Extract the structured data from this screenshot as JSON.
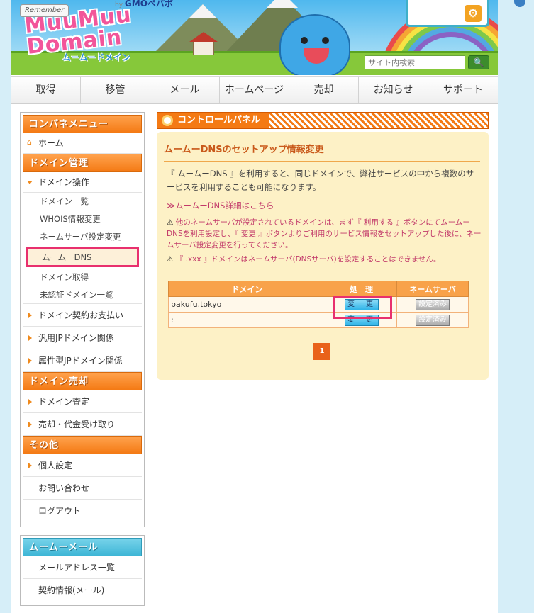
{
  "header": {
    "remember_badge": "Remember",
    "byline": "GMOペパボ",
    "logo_text": "MuuMuu Domain",
    "logo_sub": "ムームードメイン",
    "search": {
      "placeholder": "サイト内検索",
      "button_icon": "search-icon"
    },
    "login_icon": "gear-icon"
  },
  "nav": {
    "items": [
      {
        "label": "取得"
      },
      {
        "label": "移管"
      },
      {
        "label": "メール"
      },
      {
        "label": "ホームページ"
      },
      {
        "label": "売却"
      },
      {
        "label": "お知らせ"
      },
      {
        "label": "サポート"
      }
    ]
  },
  "sidebar": {
    "title": "コンパネメニュー",
    "home": "ホーム",
    "sections": {
      "domain_mgmt": "ドメイン管理",
      "domain_sale": "ドメイン売却",
      "other": "その他"
    },
    "domain_ops": "ドメイン操作",
    "domain_ops_items": [
      {
        "label": "ドメイン一覧"
      },
      {
        "label": "WHOIS情報変更"
      },
      {
        "label": "ネームサーバ設定変更"
      },
      {
        "label": "ムームーDNS"
      },
      {
        "label": "ドメイン取得"
      },
      {
        "label": "未認証ドメイン一覧"
      }
    ],
    "contract_payment": "ドメイン契約お支払い",
    "generic_jp": "汎用JPドメイン関係",
    "attribute_jp": "属性型JPドメイン関係",
    "appraisal": "ドメイン査定",
    "sale_payment": "売却・代金受け取り",
    "personal_settings": "個人設定",
    "contact": "お問い合わせ",
    "logout": "ログアウト"
  },
  "mail": {
    "title": "ムームーメール",
    "items": [
      {
        "label": "メールアドレス一覧"
      },
      {
        "label": "契約情報(メール)"
      }
    ]
  },
  "panel": {
    "title": "コントロールパネル",
    "heading": "ムームーDNSのセットアップ情報変更",
    "description": "『 ムームーDNS 』を利用すると、同じドメインで、弊社サービスの中から複数のサービスを利用することも可能になります。",
    "link": "ムームーDNS詳細はこちら",
    "note1": "他のネームサーバが設定されているドメインは、まず『 利用する 』ボタンにてムームーDNSを利用設定し、『 変更 』ボタンよりご利用のサービス情報をセットアップした後に、ネームサーバ設定変更を行ってください。",
    "note2": "『 .xxx 』ドメインはネームサーバ(DNSサーバ)を設定することはできません。",
    "table": {
      "headers": [
        "ドメイン",
        "処　理",
        "ネームサーバ"
      ],
      "rows": [
        {
          "domain": "bakufu.tokyo",
          "action": "変　更",
          "ns": "設定済み"
        },
        {
          "domain": ":",
          "action": "変　更",
          "ns": "設定済み"
        }
      ]
    },
    "page": "1"
  }
}
